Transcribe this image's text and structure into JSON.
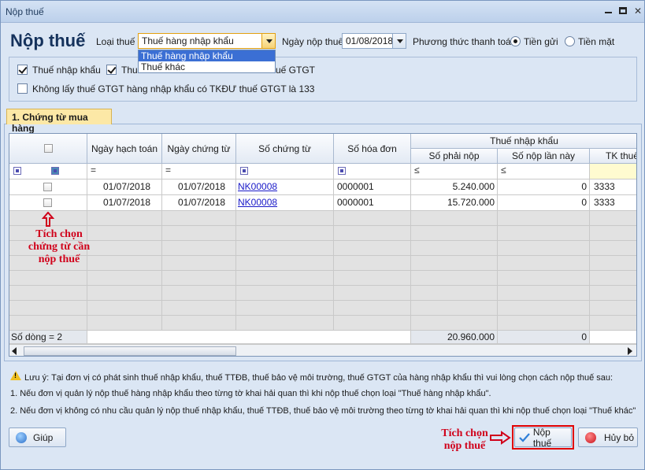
{
  "window": {
    "title": "Nộp thuế"
  },
  "header": {
    "heading": "Nộp thuế",
    "tax_type_label": "Loại thuế",
    "tax_type_value": "Thuế hàng nhập khẩu",
    "tax_type_options": [
      "Thuế hàng nhập khẩu",
      "Thuế khác"
    ],
    "pay_date_label": "Ngày nộp thuế",
    "pay_date_value": "01/08/2018",
    "method_label": "Phương thức thanh toán",
    "method_deposit": "Tiền gửi",
    "method_cash": "Tiền mặt"
  },
  "options": {
    "import_tax": "Thuế nhập khẩu",
    "second_prefix": "Thu",
    "vat_suffix": "uế GTGT",
    "no_vat_133": "Không lấy thuế GTGT hàng nhập khẩu có TKĐƯ thuế GTGT là 133"
  },
  "tab": {
    "label": "1. Chứng từ mua hàng"
  },
  "grid": {
    "columns": {
      "posting_date": "Ngày hạch toán",
      "voucher_date": "Ngày chứng từ",
      "voucher_no": "Số chứng từ",
      "invoice_no": "Số hóa đơn",
      "group_import_tax": "Thuế nhập khẩu",
      "amount_due": "Số phải nộp",
      "amount_this": "Số nộp lần này",
      "account": "TK thuế"
    },
    "filter_ops": {
      "eq": "=",
      "le": "≤"
    },
    "rows": [
      {
        "posting_date": "01/07/2018",
        "voucher_date": "01/07/2018",
        "voucher_no": "NK00008",
        "invoice_no": "0000001",
        "amount_due": "5.240.000",
        "amount_this": "0",
        "account": "3333"
      },
      {
        "posting_date": "01/07/2018",
        "voucher_date": "01/07/2018",
        "voucher_no": "NK00008",
        "invoice_no": "0000001",
        "amount_due": "15.720.000",
        "amount_this": "0",
        "account": "3333"
      }
    ],
    "footer": {
      "row_count": "Số dòng = 2",
      "total_due": "20.960.000",
      "total_this": "0"
    }
  },
  "annotations": {
    "select_vouchers": [
      "Tích chọn",
      "chứng từ cần",
      "nộp thuế"
    ],
    "select_pay": [
      "Tích chọn",
      "nộp thuế"
    ]
  },
  "note": {
    "line1": "Lưu ý: Tại đơn vị có phát sinh thuế nhập khẩu, thuế TTĐB, thuế bảo vệ môi trường, thuế GTGT của hàng nhập khẩu thì vui lòng chọn cách nộp thuế sau:",
    "line2": "1. Nếu đơn vị quản lý nộp thuế hàng nhập khẩu theo từng tờ khai hải quan thì khi nộp thuế chọn loại \"Thuế hàng nhập khẩu\".",
    "line3": "2. Nếu đơn vị không có nhu cầu quản lý nộp thuế nhập khẩu, thuế TTĐB, thuế bảo vệ môi trường theo từng tờ khai hải quan thì khi nộp thuế chọn loại \"Thuế khác\""
  },
  "buttons": {
    "help": "Giúp",
    "pay": "Nộp thuế",
    "cancel": "Hủy bỏ"
  },
  "colors": {
    "annotation": "#d0021b",
    "accent": "#15325c"
  }
}
